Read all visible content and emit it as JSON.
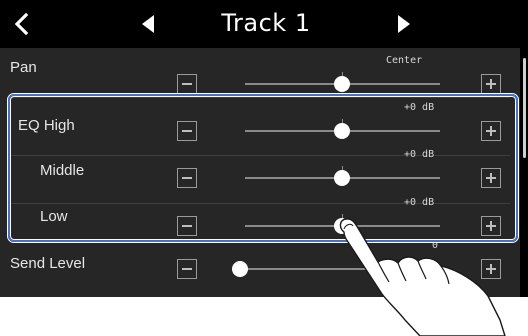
{
  "header": {
    "title": "Track 1",
    "back_icon": "chevron-left-icon",
    "prev_icon": "triangle-left-icon",
    "next_icon": "triangle-right-icon"
  },
  "rows": [
    {
      "label": "Pan",
      "value": "Center",
      "level": 0.5
    },
    {
      "label": "EQ High",
      "value": "+0 dB",
      "level": 0.5
    },
    {
      "label": "Middle",
      "value": "+0 dB",
      "level": 0.5
    },
    {
      "label": "Low",
      "value": "+0 dB",
      "level": 0.5
    },
    {
      "label": "Send Level",
      "value": "0",
      "level": 0.0
    }
  ],
  "buttons": {
    "minus_icon": "minus-box-icon",
    "plus_icon": "plus-box-icon"
  },
  "colors": {
    "background": "#000000",
    "list_background": "#262626",
    "highlight": "#4a6fc4",
    "knob": "#ffffff"
  }
}
